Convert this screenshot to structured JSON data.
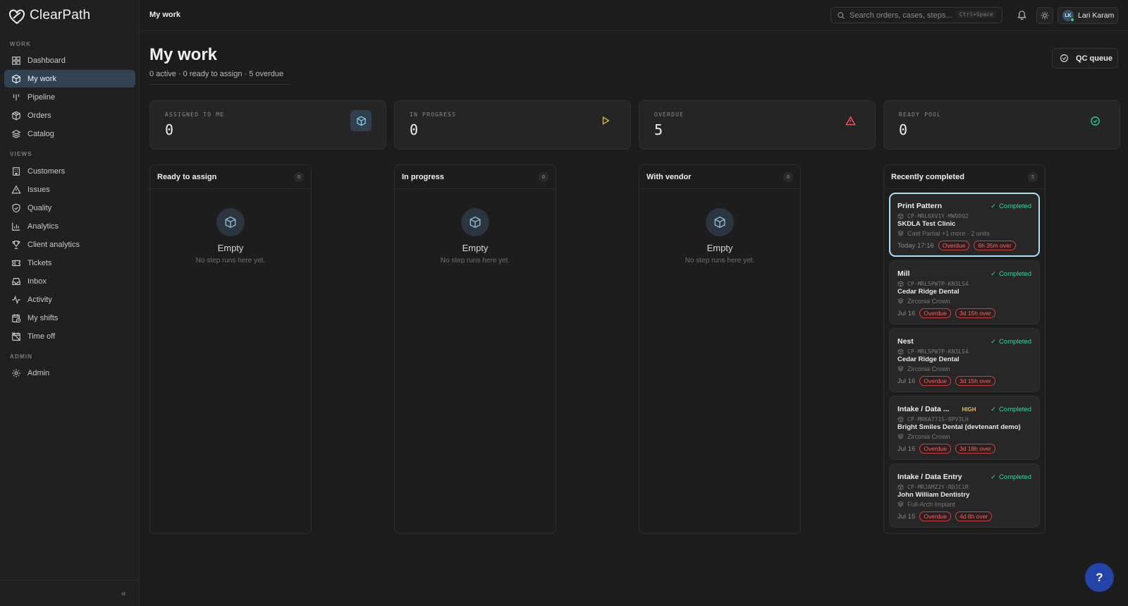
{
  "app": {
    "brand": "ClearPath"
  },
  "sidebar": {
    "sections": {
      "work": "WORK",
      "views": "VIEWS",
      "admin": "ADMIN"
    },
    "items": [
      {
        "label": "Dashboard",
        "icon": "grid-icon"
      },
      {
        "label": "My work",
        "icon": "box-icon",
        "active": true
      },
      {
        "label": "Pipeline",
        "icon": "pipeline-icon"
      },
      {
        "label": "Orders",
        "icon": "package-icon"
      },
      {
        "label": "Catalog",
        "icon": "layers-icon"
      },
      {
        "label": "Customers",
        "icon": "building-icon"
      },
      {
        "label": "Issues",
        "icon": "warning-icon"
      },
      {
        "label": "Quality",
        "icon": "shield-icon"
      },
      {
        "label": "Analytics",
        "icon": "bar-chart-icon"
      },
      {
        "label": "Client analytics",
        "icon": "trophy-icon"
      },
      {
        "label": "Tickets",
        "icon": "ticket-icon"
      },
      {
        "label": "Inbox",
        "icon": "inbox-icon"
      },
      {
        "label": "Activity",
        "icon": "activity-icon"
      },
      {
        "label": "My shifts",
        "icon": "calendar-clock-icon"
      },
      {
        "label": "Time off",
        "icon": "calendar-off-icon"
      },
      {
        "label": "Admin",
        "icon": "gear-icon"
      }
    ],
    "collapse_glyph": "«"
  },
  "header": {
    "title": "My work",
    "search_placeholder": "Search orders, cases, steps...",
    "search_shortcut": "Ctrl+Space",
    "user": {
      "initials": "LK",
      "name": "Lari Karam"
    }
  },
  "page": {
    "title": "My work",
    "subtitle": "0 active · 0 ready to assign · 5 overdue",
    "qc_button": "QC queue"
  },
  "stats": [
    {
      "label": "ASSIGNED TO ME",
      "value": "0",
      "icon": "box-icon",
      "color": "#7fb8d6"
    },
    {
      "label": "IN PROGRESS",
      "value": "0",
      "icon": "play-icon",
      "color": "#e5b53a"
    },
    {
      "label": "OVERDUE",
      "value": "5",
      "icon": "warning-icon",
      "color": "#ee5d5d"
    },
    {
      "label": "READY POOL",
      "value": "0",
      "icon": "check-circle-icon",
      "color": "#35c98f"
    }
  ],
  "columns": [
    {
      "title": "Ready to assign",
      "count": "0",
      "empty_title": "Empty",
      "empty_sub": "No step runs here yet."
    },
    {
      "title": "In progress",
      "count": "0",
      "empty_title": "Empty",
      "empty_sub": "No step runs here yet."
    },
    {
      "title": "With vendor",
      "count": "0",
      "empty_title": "Empty",
      "empty_sub": "No step runs here yet."
    },
    {
      "title": "Recently completed",
      "count": "5"
    }
  ],
  "completed_cards": [
    {
      "step": "Print Pattern",
      "priority": "",
      "status": "Completed",
      "code": "CP-MRL6XV1Y-MW9DQ2",
      "clinic": "SKDLA Test Clinic",
      "product": "Cast Partial +1 more · 2 units",
      "date": "Today 17:16",
      "badge": "Overdue",
      "over": "6h 35m over",
      "selected": true
    },
    {
      "step": "Mill",
      "priority": "",
      "status": "Completed",
      "code": "CP-MRL5PW7P-KN3LS4",
      "clinic": "Cedar Ridge Dental",
      "product": "Zirconia Crown",
      "date": "Jul 16",
      "badge": "Overdue",
      "over": "3d 15h over"
    },
    {
      "step": "Nest",
      "priority": "",
      "status": "Completed",
      "code": "CP-MRL5PW7P-KN3LS4",
      "clinic": "Cedar Ridge Dental",
      "product": "Zirconia Crown",
      "date": "Jul 16",
      "badge": "Overdue",
      "over": "3d 15h over"
    },
    {
      "step": "Intake / Data ...",
      "priority": "HIGH",
      "status": "Completed",
      "code": "CP-MRKA771S-8PV3LH",
      "clinic": "Bright Smiles Dental (devtenant demo)",
      "product": "Zirconia Crown",
      "date": "Jul 16",
      "badge": "Overdue",
      "over": "3d 18h over"
    },
    {
      "step": "Intake / Data Entry",
      "priority": "",
      "status": "Completed",
      "code": "CP-MRJAMZ2Y-RDJC1R",
      "clinic": "John William Dentistry",
      "product": "Full-Arch Implant",
      "date": "Jul 15",
      "badge": "Overdue",
      "over": "4d 8h over"
    }
  ],
  "help_glyph": "?"
}
